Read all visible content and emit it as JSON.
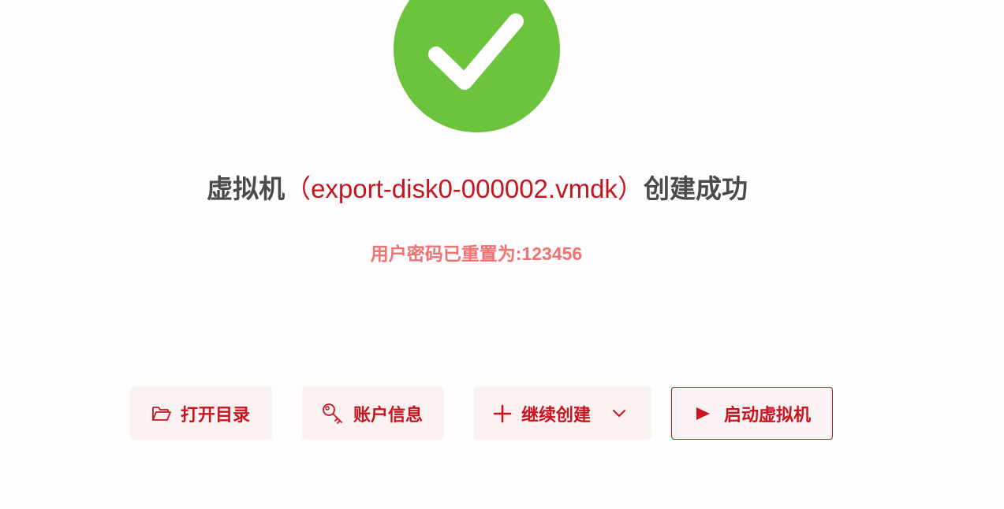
{
  "result": {
    "title_prefix": "虚拟机",
    "title_name": "（export-disk0-000002.vmdk）",
    "title_suffix": "创建成功",
    "password_notice": "用户密码已重置为:123456"
  },
  "icons": {
    "success": "check-circle-icon",
    "open": "folder-open-icon",
    "account": "key-icon",
    "continue": "plus-icon",
    "dropdown": "chevron-down-icon",
    "start": "play-icon"
  },
  "actions": {
    "open_directory": "打开目录",
    "account_info": "账户信息",
    "continue_create": "继续创建",
    "start_vm": "启动虚拟机"
  },
  "colors": {
    "success_green": "#6bc43b",
    "accent_red": "#c8141e",
    "notice_pink": "#ef7272",
    "text_dark": "#4a4a4a",
    "button_bg": "#fbf1f1"
  }
}
